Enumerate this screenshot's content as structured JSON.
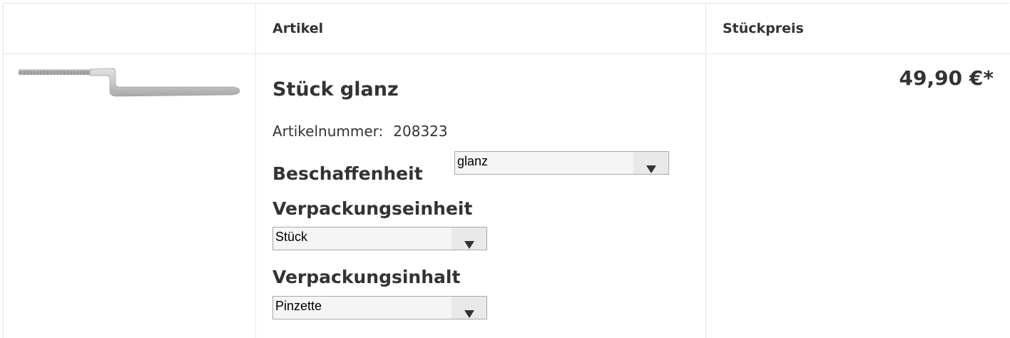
{
  "table": {
    "headers": {
      "image": "",
      "article": "Artikel",
      "unit_price": "Stückpreis"
    }
  },
  "product": {
    "image_icon": "tweezers-image",
    "title": "Stück glanz",
    "sku_label": "Artikelnummer:",
    "sku_value": "208323",
    "price": "49,90 €*",
    "options": {
      "finish": {
        "label": "Beschaffenheit",
        "selected": "glanz"
      },
      "packaging_unit": {
        "label": "Verpackungseinheit",
        "selected": "Stück"
      },
      "packaging_content": {
        "label": "Verpackungsinhalt",
        "selected": "Pinzette"
      }
    }
  }
}
